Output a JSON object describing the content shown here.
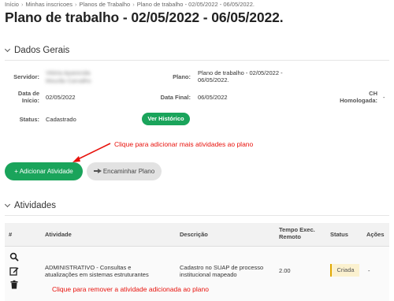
{
  "breadcrumb": [
    "Início",
    "Minhas inscricoes",
    "Planos de Trabalho",
    "Plano de trabalho - 02/05/2022 - 06/05/2022."
  ],
  "page_title": "Plano de trabalho - 02/05/2022 - 06/05/2022.",
  "dados_gerais": {
    "heading": "Dados Gerais",
    "servidor_label": "Servidor:",
    "servidor_value": "Vitória Aparecida Mourão Carvalho",
    "plano_label": "Plano:",
    "plano_value_line1": "Plano de trabalho - 02/05/2022 -",
    "plano_value_line2": "06/05/2022.",
    "data_inicio_label_line1": "Data de",
    "data_inicio_label_line2": "Início:",
    "data_inicio_value": "02/05/2022",
    "data_final_label": "Data Final:",
    "data_final_value": "06/05/2022",
    "ch_label_line1": "CH",
    "ch_label_line2": "Homologada:",
    "ch_value": "-",
    "status_label": "Status:",
    "status_value": "Cadastrado",
    "historico_button": "Ver Histórico"
  },
  "actions": {
    "add_button": "+  Adicionar Atividade",
    "forward_button": "Encaminhar Plano"
  },
  "annotations": {
    "add_hint": "Clique para adicionar mais atividades ao plano",
    "remove_hint": "Clique para remover a atividade adicionada ao plano"
  },
  "atividades": {
    "heading": "Atividades",
    "columns": {
      "num": "#",
      "atividade": "Atividade",
      "descricao": "Descrição",
      "tempo_line1": "Tempo Exec.",
      "tempo_line2": "Remoto",
      "status": "Status",
      "acoes": "Ações"
    },
    "rows": [
      {
        "atividade_line1": "ADMINISTRATIVO - Consultas e",
        "atividade_line2": "atualizações em sistemas estruturantes",
        "descricao_line1": "Cadastro no SUAP de processo",
        "descricao_line2": "institucional mapeado",
        "tempo": "2.00",
        "status": "Criada",
        "acoes": "-"
      }
    ]
  },
  "colors": {
    "primary_green": "#1aa45b",
    "annotation_red": "#e8120c",
    "badge_bg": "#fbf1cf"
  },
  "icons": [
    "chevron-down-icon",
    "search-icon",
    "edit-icon",
    "trash-icon",
    "hand-pointer-icon",
    "arrow-icon"
  ]
}
